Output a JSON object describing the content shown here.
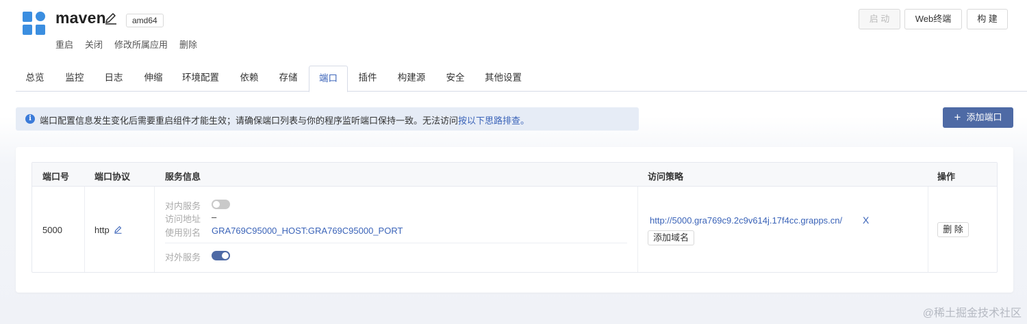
{
  "app": {
    "name": "maven",
    "arch": "amd64",
    "actions": [
      "重启",
      "关闭",
      "修改所属应用",
      "删除"
    ]
  },
  "top_buttons": {
    "start": "启 动",
    "web_terminal": "Web终端",
    "build": "构 建"
  },
  "tabs": [
    {
      "label": "总览"
    },
    {
      "label": "监控"
    },
    {
      "label": "日志"
    },
    {
      "label": "伸缩"
    },
    {
      "label": "环境配置"
    },
    {
      "label": "依赖"
    },
    {
      "label": "存储"
    },
    {
      "label": "端口",
      "active": true
    },
    {
      "label": "插件"
    },
    {
      "label": "构建源"
    },
    {
      "label": "安全"
    },
    {
      "label": "其他设置"
    }
  ],
  "notice": {
    "text": "端口配置信息发生变化后需要重启组件才能生效；请确保端口列表与你的程序监听端口保持一致。无法访问",
    "link": "按以下思路排查。"
  },
  "add_port_button": "添加端口",
  "table": {
    "headers": {
      "port": "端口号",
      "protocol": "端口协议",
      "service": "服务信息",
      "policy": "访问策略",
      "ops": "操作"
    },
    "rows": [
      {
        "port": "5000",
        "protocol": "http",
        "inner_service_label": "对内服务",
        "inner_service_on": false,
        "access_address_label": "访问地址",
        "access_address": "–",
        "alias_label": "使用别名",
        "alias": "GRA769C95000_HOST:GRA769C95000_PORT",
        "outer_service_label": "对外服务",
        "outer_service_on": true,
        "domain": "http://5000.gra769c9.2c9v614j.17f4cc.grapps.cn/",
        "remove_domain": "X",
        "add_domain": "添加域名",
        "delete": "删 除"
      }
    ]
  },
  "watermark": "@稀土掘金技术社区",
  "colors": {
    "accent": "#3a63b8",
    "primary_button": "#4e6aa5",
    "logo": "#3b8ee0",
    "notice_bg": "#e6ecf6"
  }
}
